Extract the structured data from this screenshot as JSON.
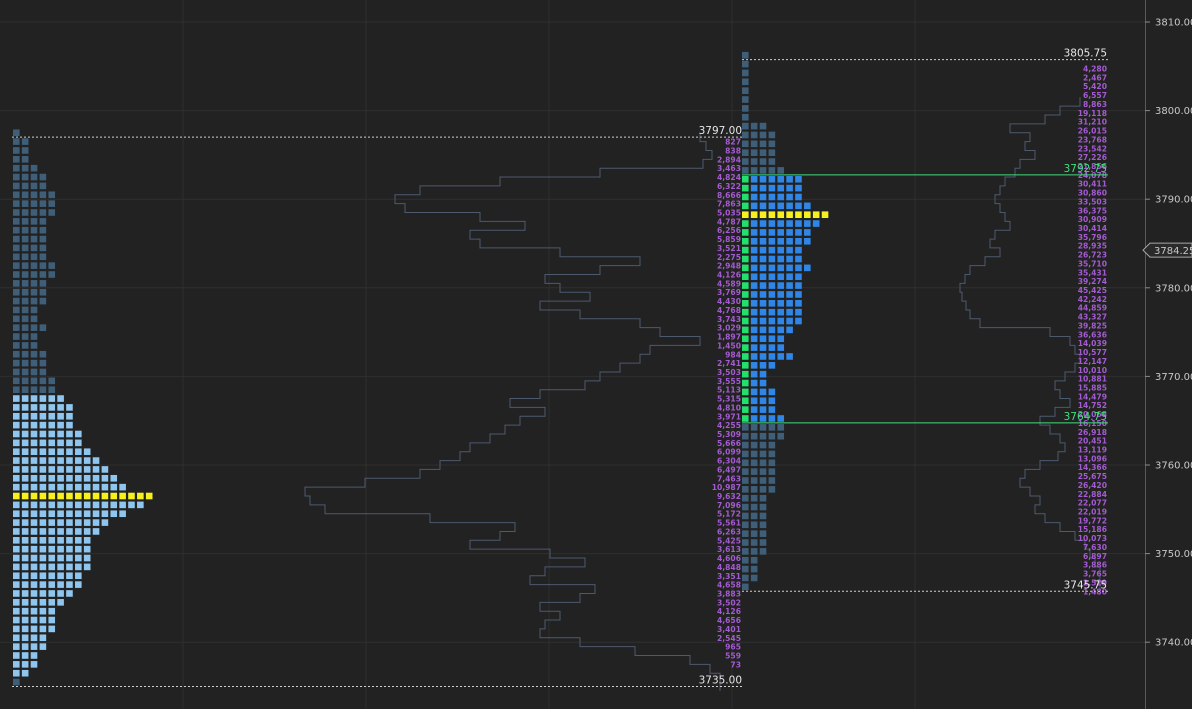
{
  "chart_data": {
    "type": "volume-profile",
    "y_axis": {
      "ticks": [
        3810,
        3800,
        3790,
        3780,
        3770,
        3760,
        3750,
        3740
      ],
      "tick_labels": [
        "3810.00",
        "3800.00",
        "3790.00",
        "3780.00",
        "3770.00",
        "3760.00",
        "3750.00",
        "3740.00"
      ],
      "current_price": "3784.25",
      "ylim": [
        3733.5,
        3812.5
      ]
    },
    "colors": {
      "background": "#222222",
      "grid": "#2f2f2f",
      "outside_value_area": "#3f5e78",
      "left_value_area": "#8ec6ef",
      "right_value_area": "#2f86e6",
      "poc": "#f5f01e",
      "green_column": "#22e06b",
      "outline": "#4d5a6e",
      "volume_text": "#a45bd1",
      "level_line": "#cfcfcf",
      "va_line": "#3ee07a"
    },
    "left_profile": {
      "high": "3797.00",
      "low": "3735.00",
      "high_value": 3797.0,
      "low_value": 3735.0,
      "poc": 3756.25,
      "value_area": [
        3736.0,
        3767.75
      ],
      "bins": [
        [
          3797.5,
          1
        ],
        [
          3796.5,
          2
        ],
        [
          3795.5,
          2
        ],
        [
          3794.5,
          2
        ],
        [
          3793.5,
          3
        ],
        [
          3792.5,
          4
        ],
        [
          3791.5,
          4
        ],
        [
          3790.5,
          5
        ],
        [
          3789.5,
          5
        ],
        [
          3788.5,
          5
        ],
        [
          3787.5,
          4
        ],
        [
          3786.5,
          4
        ],
        [
          3785.5,
          4
        ],
        [
          3784.5,
          4
        ],
        [
          3783.5,
          4
        ],
        [
          3782.5,
          5
        ],
        [
          3781.5,
          5
        ],
        [
          3780.5,
          4
        ],
        [
          3779.5,
          4
        ],
        [
          3778.5,
          4
        ],
        [
          3777.5,
          3
        ],
        [
          3776.5,
          3
        ],
        [
          3775.5,
          4
        ],
        [
          3774.5,
          3
        ],
        [
          3773.5,
          3
        ],
        [
          3772.5,
          4
        ],
        [
          3771.5,
          4
        ],
        [
          3770.5,
          4
        ],
        [
          3769.5,
          5
        ],
        [
          3768.5,
          5
        ],
        [
          3767.5,
          6
        ],
        [
          3766.5,
          7
        ],
        [
          3765.5,
          7
        ],
        [
          3764.5,
          7
        ],
        [
          3763.5,
          8
        ],
        [
          3762.5,
          8
        ],
        [
          3761.5,
          9
        ],
        [
          3760.5,
          10
        ],
        [
          3759.5,
          11
        ],
        [
          3758.5,
          12
        ],
        [
          3757.5,
          13
        ],
        [
          3756.5,
          16
        ],
        [
          3755.5,
          15
        ],
        [
          3754.5,
          13
        ],
        [
          3753.5,
          11
        ],
        [
          3752.5,
          10
        ],
        [
          3751.5,
          9
        ],
        [
          3750.5,
          9
        ],
        [
          3749.5,
          9
        ],
        [
          3748.5,
          9
        ],
        [
          3747.5,
          8
        ],
        [
          3746.5,
          8
        ],
        [
          3745.5,
          7
        ],
        [
          3744.5,
          6
        ],
        [
          3743.5,
          5
        ],
        [
          3742.5,
          5
        ],
        [
          3741.5,
          5
        ],
        [
          3740.5,
          4
        ],
        [
          3739.5,
          4
        ],
        [
          3738.5,
          3
        ],
        [
          3737.5,
          3
        ],
        [
          3736.5,
          2
        ],
        [
          3735.5,
          1
        ]
      ]
    },
    "middle_outline": {
      "steps": [
        [
          3797.0,
          700
        ],
        [
          3796.0,
          706
        ],
        [
          3795.0,
          712
        ],
        [
          3794.0,
          703
        ],
        [
          3793.0,
          600
        ],
        [
          3792.0,
          500
        ],
        [
          3791.0,
          420
        ],
        [
          3790.0,
          395
        ],
        [
          3789.0,
          405
        ],
        [
          3788.0,
          480
        ],
        [
          3787.0,
          525
        ],
        [
          3786.0,
          470
        ],
        [
          3785.0,
          480
        ],
        [
          3784.0,
          560
        ],
        [
          3783.0,
          640
        ],
        [
          3782.0,
          600
        ],
        [
          3781.0,
          545
        ],
        [
          3780.0,
          560
        ],
        [
          3779.0,
          590
        ],
        [
          3778.0,
          540
        ],
        [
          3777.0,
          580
        ],
        [
          3776.0,
          640
        ],
        [
          3775.0,
          660
        ],
        [
          3774.0,
          700
        ],
        [
          3773.0,
          650
        ],
        [
          3772.0,
          640
        ],
        [
          3771.0,
          620
        ],
        [
          3770.0,
          600
        ],
        [
          3769.0,
          585
        ],
        [
          3768.0,
          540
        ],
        [
          3767.0,
          510
        ],
        [
          3766.0,
          545
        ],
        [
          3765.0,
          520
        ],
        [
          3764.0,
          505
        ],
        [
          3763.0,
          490
        ],
        [
          3762.0,
          470
        ],
        [
          3761.0,
          460
        ],
        [
          3760.0,
          440
        ],
        [
          3759.0,
          420
        ],
        [
          3758.0,
          365
        ],
        [
          3757.0,
          305
        ],
        [
          3756.0,
          310
        ],
        [
          3755.0,
          325
        ],
        [
          3754.0,
          430
        ],
        [
          3753.0,
          515
        ],
        [
          3752.0,
          500
        ],
        [
          3751.0,
          470
        ],
        [
          3750.0,
          550
        ],
        [
          3749.0,
          585
        ],
        [
          3748.0,
          545
        ],
        [
          3747.0,
          530
        ],
        [
          3746.0,
          595
        ],
        [
          3745.0,
          580
        ],
        [
          3744.0,
          540
        ],
        [
          3743.0,
          560
        ],
        [
          3742.0,
          545
        ],
        [
          3741.0,
          540
        ],
        [
          3740.0,
          580
        ],
        [
          3739.0,
          635
        ],
        [
          3738.0,
          690
        ],
        [
          3737.0,
          710
        ],
        [
          3736.0,
          720
        ],
        [
          3735.0,
          720
        ]
      ]
    },
    "right_profile": {
      "high": "3805.75",
      "low": "3745.75",
      "vah": "3792.75",
      "val": "3764.75",
      "high_value": 3805.75,
      "low_value": 3745.75,
      "vah_value": 3792.75,
      "val_value": 3764.75,
      "poc": 3788.25,
      "bins": [
        [
          3806.25,
          1
        ],
        [
          3805.25,
          1
        ],
        [
          3804.25,
          1
        ],
        [
          3803.25,
          1
        ],
        [
          3802.25,
          1
        ],
        [
          3801.25,
          1
        ],
        [
          3800.25,
          1
        ],
        [
          3799.25,
          1
        ],
        [
          3798.25,
          3
        ],
        [
          3797.25,
          4
        ],
        [
          3796.25,
          4
        ],
        [
          3795.25,
          4
        ],
        [
          3794.25,
          4
        ],
        [
          3793.25,
          5
        ],
        [
          3792.25,
          7
        ],
        [
          3791.25,
          7
        ],
        [
          3790.25,
          7
        ],
        [
          3789.25,
          8
        ],
        [
          3788.25,
          10
        ],
        [
          3787.25,
          9
        ],
        [
          3786.25,
          8
        ],
        [
          3785.25,
          8
        ],
        [
          3784.25,
          7
        ],
        [
          3783.25,
          7
        ],
        [
          3782.25,
          8
        ],
        [
          3781.25,
          7
        ],
        [
          3780.25,
          7
        ],
        [
          3779.25,
          7
        ],
        [
          3778.25,
          7
        ],
        [
          3777.25,
          7
        ],
        [
          3776.25,
          7
        ],
        [
          3775.25,
          6
        ],
        [
          3774.25,
          5
        ],
        [
          3773.25,
          5
        ],
        [
          3772.25,
          6
        ],
        [
          3771.25,
          4
        ],
        [
          3770.25,
          3
        ],
        [
          3769.25,
          3
        ],
        [
          3768.25,
          4
        ],
        [
          3767.25,
          4
        ],
        [
          3766.25,
          4
        ],
        [
          3765.25,
          5
        ],
        [
          3764.25,
          5
        ],
        [
          3763.25,
          5
        ],
        [
          3762.25,
          4
        ],
        [
          3761.25,
          4
        ],
        [
          3760.25,
          4
        ],
        [
          3759.25,
          4
        ],
        [
          3758.25,
          4
        ],
        [
          3757.25,
          4
        ],
        [
          3756.25,
          3
        ],
        [
          3755.25,
          3
        ],
        [
          3754.25,
          3
        ],
        [
          3753.25,
          3
        ],
        [
          3752.25,
          3
        ],
        [
          3751.25,
          3
        ],
        [
          3750.25,
          3
        ],
        [
          3749.25,
          2
        ],
        [
          3748.25,
          2
        ],
        [
          3747.25,
          2
        ],
        [
          3746.25,
          1
        ]
      ]
    },
    "middle_volumes": {
      "labels": [
        "827",
        "838",
        "2,894",
        "3,463",
        "4,824",
        "6,322",
        "8,666",
        "7,863",
        "5,035",
        "4,787",
        "6,256",
        "5,859",
        "3,521",
        "2,275",
        "2,948",
        "4,126",
        "4,589",
        "3,769",
        "4,430",
        "4,768",
        "3,743",
        "3,029",
        "1,897",
        "1,450",
        "984",
        "2,741",
        "3,503",
        "3,555",
        "5,113",
        "5,315",
        "4,810",
        "3,971",
        "4,255",
        "5,309",
        "5,666",
        "6,099",
        "6,304",
        "6,497",
        "7,463",
        "10,987",
        "9,632",
        "7,096",
        "5,172",
        "5,561",
        "6,263",
        "5,425",
        "3,613",
        "4,606",
        "4,848",
        "3,351",
        "4,658",
        "3,883",
        "3,502",
        "4,126",
        "4,656",
        "3,401",
        "2,545",
        "965",
        "559",
        "73"
      ],
      "top_price": 3796.5,
      "step": 1
    },
    "right_volumes": {
      "labels": [
        "4,280",
        "2,467",
        "5,420",
        "6,557",
        "8,863",
        "19,118",
        "31,210",
        "26,015",
        "23,768",
        "23,542",
        "27,226",
        "21,856",
        "24,078",
        "30,411",
        "30,860",
        "33,503",
        "36,375",
        "30,909",
        "30,414",
        "35,796",
        "28,935",
        "26,723",
        "35,710",
        "35,431",
        "39,274",
        "45,425",
        "42,242",
        "44,859",
        "43,327",
        "39,825",
        "36,636",
        "14,039",
        "10,577",
        "12,147",
        "10,010",
        "10,881",
        "15,885",
        "14,479",
        "14,752",
        "20,068",
        "16,150",
        "26,918",
        "20,451",
        "13,119",
        "13,096",
        "14,366",
        "25,675",
        "26,420",
        "22,884",
        "22,077",
        "22,019",
        "19,772",
        "15,186",
        "10,073",
        "7,630",
        "6,897",
        "3,886",
        "3,765",
        "2,529",
        "1,480"
      ],
      "top_price": 3804.75,
      "step": 1
    },
    "right_outline": {
      "steps": [
        [
          3801.0,
          1080
        ],
        [
          3800.0,
          1060
        ],
        [
          3799.0,
          1045
        ],
        [
          3798.0,
          1010
        ],
        [
          3797.0,
          1030
        ],
        [
          3796.0,
          1025
        ],
        [
          3795.0,
          1035
        ],
        [
          3794.0,
          1020
        ],
        [
          3793.0,
          1015
        ],
        [
          3792.0,
          1005
        ],
        [
          3791.0,
          1000
        ],
        [
          3790.0,
          995
        ],
        [
          3789.0,
          1000
        ],
        [
          3788.0,
          1005
        ],
        [
          3787.0,
          1010
        ],
        [
          3786.0,
          995
        ],
        [
          3785.0,
          990
        ],
        [
          3784.0,
          1000
        ],
        [
          3783.0,
          985
        ],
        [
          3782.0,
          970
        ],
        [
          3781.0,
          965
        ],
        [
          3780.0,
          960
        ],
        [
          3779.0,
          962
        ],
        [
          3778.0,
          966
        ],
        [
          3777.0,
          970
        ],
        [
          3776.0,
          980
        ],
        [
          3775.0,
          1050
        ],
        [
          3774.0,
          1070
        ],
        [
          3773.0,
          1075
        ],
        [
          3772.0,
          1080
        ],
        [
          3771.0,
          1075
        ],
        [
          3770.0,
          1065
        ],
        [
          3769.0,
          1055
        ],
        [
          3768.0,
          1060
        ],
        [
          3767.0,
          1070
        ],
        [
          3766.0,
          1055
        ],
        [
          3765.0,
          1040
        ],
        [
          3764.0,
          1050
        ],
        [
          3763.0,
          1060
        ],
        [
          3762.0,
          1065
        ],
        [
          3761.0,
          1058
        ],
        [
          3760.0,
          1040
        ],
        [
          3759.0,
          1025
        ],
        [
          3758.0,
          1020
        ],
        [
          3757.0,
          1030
        ],
        [
          3756.0,
          1040
        ],
        [
          3755.0,
          1035
        ],
        [
          3754.0,
          1045
        ],
        [
          3753.0,
          1060
        ],
        [
          3752.0,
          1075
        ],
        [
          3751.0,
          1085
        ],
        [
          3750.0,
          1090
        ],
        [
          3749.0,
          1095
        ],
        [
          3748.0,
          1100
        ],
        [
          3747.0,
          1100
        ],
        [
          3746.0,
          1100
        ]
      ]
    }
  }
}
